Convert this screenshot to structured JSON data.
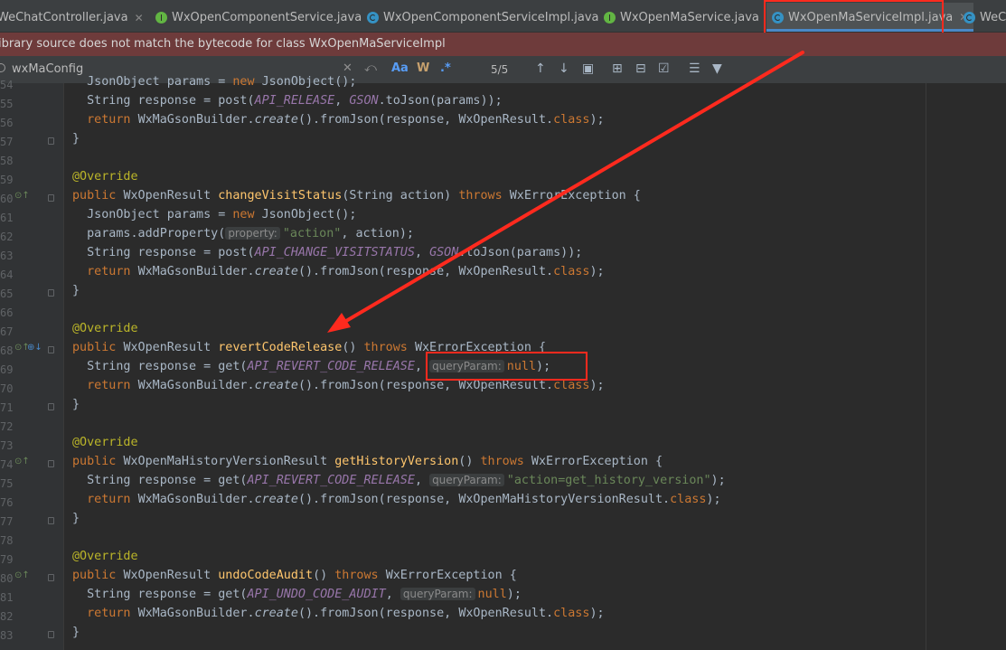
{
  "tabs": [
    {
      "label": "WeChatController.java",
      "icon": "class-icon",
      "active": false
    },
    {
      "label": "WxOpenComponentService.java",
      "icon": "interface-icon",
      "active": false
    },
    {
      "label": "WxOpenComponentServiceImpl.java",
      "icon": "class-icon",
      "active": false
    },
    {
      "label": "WxOpenMaService.java",
      "icon": "interface-icon",
      "active": false
    },
    {
      "label": "WxOpenMaServiceImpl.java",
      "icon": "class-icon",
      "active": true
    },
    {
      "label": "WeCh",
      "icon": "class-icon",
      "active": false
    }
  ],
  "banner": {
    "text": "ibrary source does not match the bytecode for class WxOpenMaServiceImpl"
  },
  "find": {
    "query": "wxMaConfig",
    "match_case": "Aa",
    "words": "W",
    "regex": ".*",
    "count": "5/5"
  },
  "line_numbers": [
    "54",
    "55",
    "56",
    "57",
    "58",
    "59",
    "60",
    "61",
    "62",
    "63",
    "64",
    "65",
    "66",
    "67",
    "68",
    "69",
    "70",
    "71",
    "72",
    "73",
    "74",
    "75",
    "76",
    "77",
    "78",
    "79",
    "80",
    "81",
    "82",
    "83"
  ],
  "code": {
    "l54a": "JsonObject params = ",
    "l54b": "new ",
    "l54c": "JsonObject();",
    "l55a": "String response = post(",
    "l55b": "API_RELEASE",
    "l55c": ", ",
    "l55d": "GSON",
    ".": ".",
    "l55e": ".toJson(params));",
    "ret": "return ",
    "builder": "WxMaGsonBuilder.",
    "create": "create",
    "fromjson": "().fromJson(response, ",
    "result": "WxOpenResult.",
    "cls": "class",
    ");": ");",
    "close": "}",
    "override": "@Override",
    "public": "public ",
    "wor": "WxOpenResult ",
    "changeVisit": "changeVisitStatus",
    "cvargs": "(String action) ",
    "throws": "throws ",
    "wxerr": "WxErrorException {",
    "jsonobj": "JsonObject params = ",
    "newkw": "new ",
    "jsonobj2": "JsonObject();",
    "addprop": "params.addProperty(",
    "hint_property": "property:",
    "action_str": "\"action\"",
    "addprop_end": ", action);",
    "strresp_post": "String response = post(",
    "api_cv": "API_CHANGE_VISITSTATUS",
    "gson": "GSON",
    "tojson": ".toJson(params));",
    "revert": "revertCodeRelease",
    "noargs": "() ",
    "strresp_get": "String response = get(",
    "api_rev": "API_REVERT_CODE_RELEASE",
    "comma": ", ",
    "hint_query": "queryParam:",
    "null": "null",
    "getend": ");",
    "hist_type": "WxOpenMaHistoryVersionResult ",
    "gethist": "getHistoryVersion",
    "hist_str": "\"action=get_history_version\"",
    "hist_result": "WxOpenMaHistoryVersionResult.",
    "undo": "undoCodeAudit",
    "api_undo": "API_UNDO_CODE_AUDIT"
  },
  "colors": {
    "keyword": "#cc7832",
    "annotation": "#bbb529",
    "method": "#ffc66d",
    "string": "#6a8759",
    "constant": "#9876aa",
    "highlight": "#ff2a1e"
  }
}
